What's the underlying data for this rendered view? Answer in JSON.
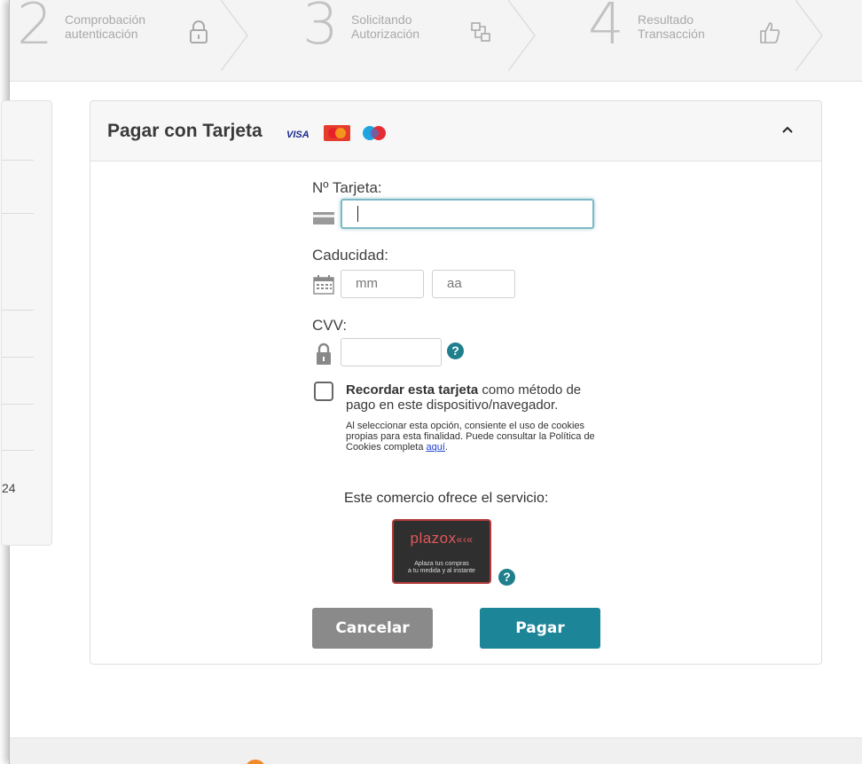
{
  "steps": [
    {
      "number": "2",
      "label_line1": "Comprobación",
      "label_line2": "autenticación",
      "icon": "lock-icon"
    },
    {
      "number": "3",
      "label_line1": "Solicitando",
      "label_line2": "Autorización",
      "icon": "network-icon"
    },
    {
      "number": "4",
      "label_line1": "Resultado",
      "label_line2": "Transacción",
      "icon": "thumbs-up-icon"
    }
  ],
  "sidebar": {
    "partial_text": "24"
  },
  "card": {
    "title": "Pagar con Tarjeta",
    "brands": [
      "VISA",
      "Mastercard",
      "Maestro"
    ],
    "collapse_icon": "chevron-up-icon"
  },
  "form": {
    "card_number_label": "Nº Tarjeta:",
    "card_number_value": "",
    "expiry_label": "Caducidad:",
    "expiry_month_placeholder": "mm",
    "expiry_year_placeholder": "aa",
    "cvv_label": "CVV:",
    "cvv_value": "",
    "help_glyph": "?"
  },
  "remember": {
    "bold": "Recordar esta tarjeta",
    "rest": " como método de pago en este dispositivo/navegador.",
    "note": "Al seleccionar esta opción, consiente el uso de cookies propias para esta finalidad. Puede consultar la Política de Cookies completa ",
    "link": "aquí",
    "link_suffix": "."
  },
  "service": {
    "text": "Este comercio ofrece el servicio:",
    "plazox_logo": "plazox",
    "plazox_arrows": "«‹«",
    "plazox_tag1": "Aplaza tus compras",
    "plazox_tag2": "a tu medida y al instante"
  },
  "buttons": {
    "cancel": "Cancelar",
    "pay": "Pagar"
  },
  "colors": {
    "accent": "#1c8597",
    "help": "#1f7f8c",
    "cancel": "#8a8a8a",
    "plazox_red": "#e0585a"
  }
}
